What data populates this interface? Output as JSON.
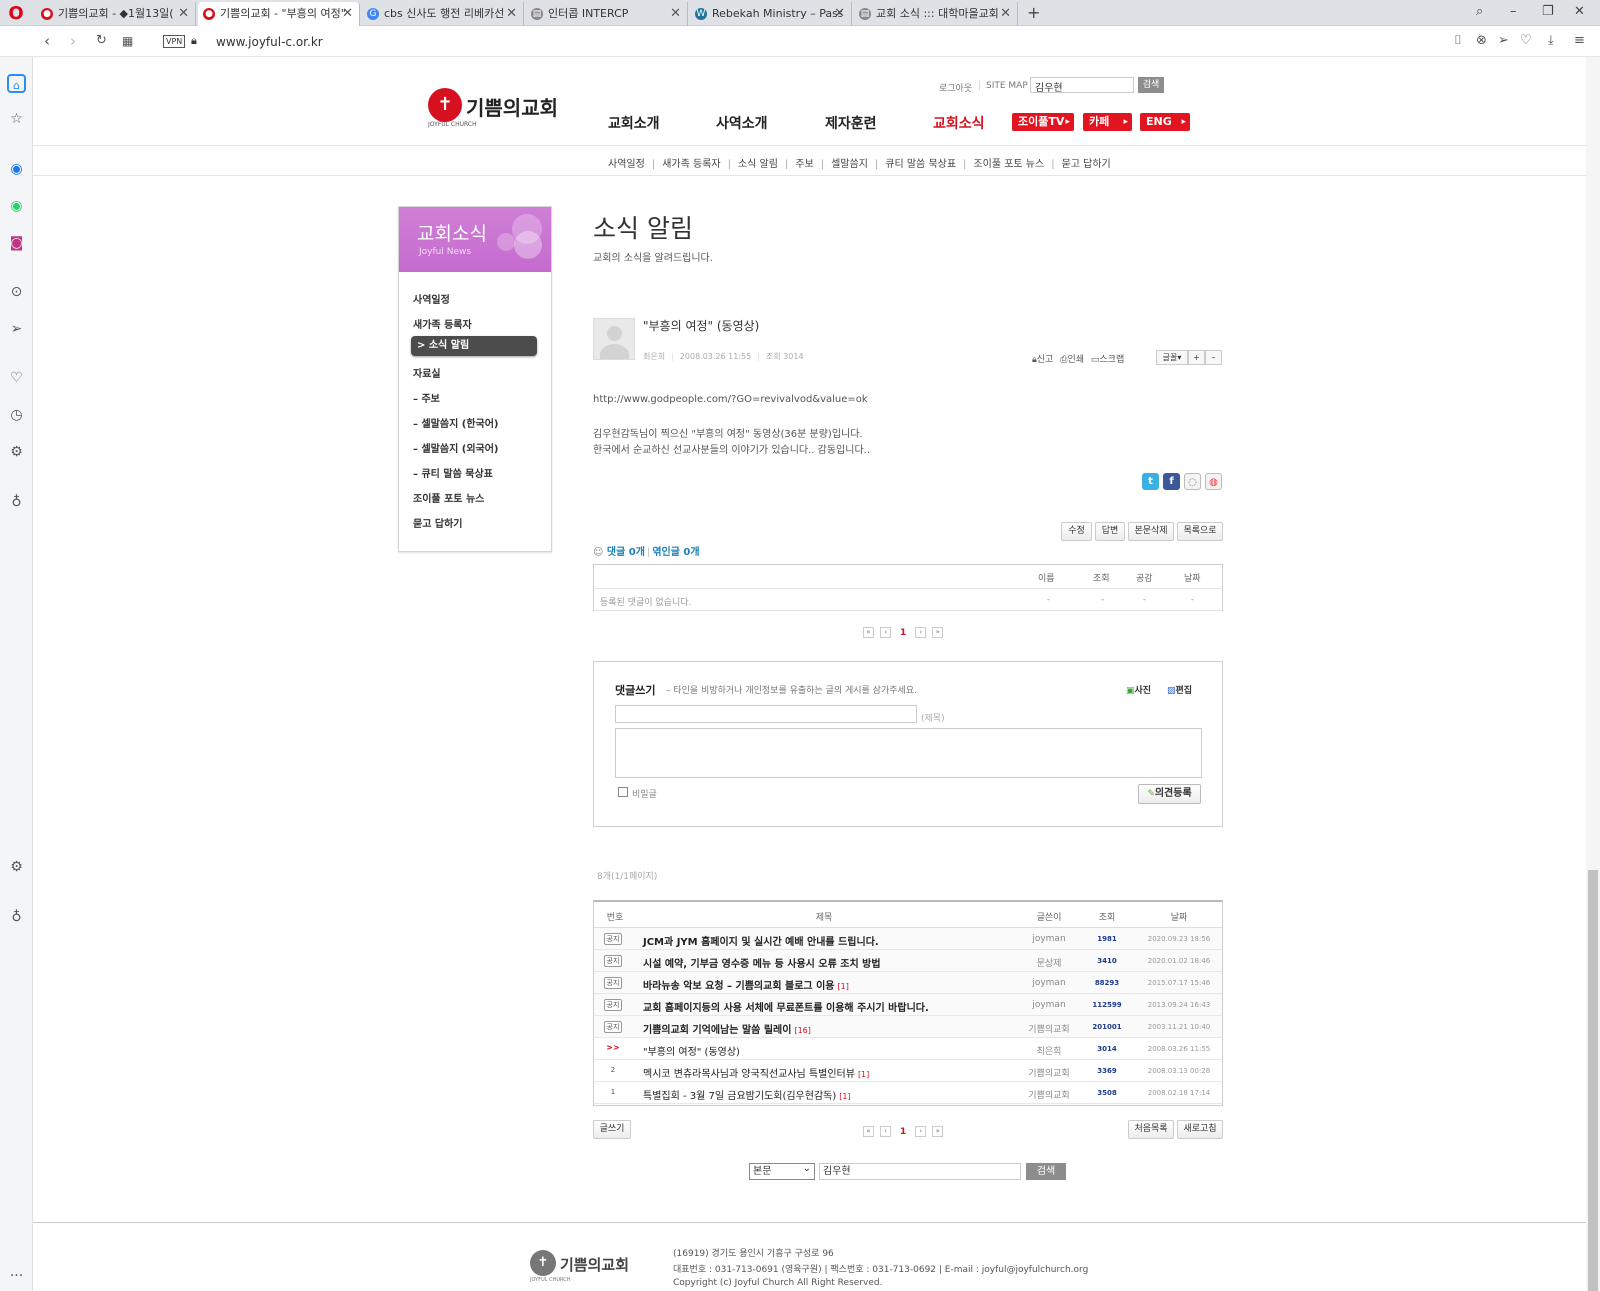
{
  "browser": {
    "tabs": [
      {
        "label": "기쁨의교회 - ◆1월13일(",
        "active": false,
        "icon_color": "#d7101f"
      },
      {
        "label": "기쁨의교회 - \"부흥의 여정\"",
        "active": true,
        "icon_color": "#d7101f"
      },
      {
        "label": "cbs 신사도 행전 리베카선",
        "active": false,
        "icon_color": "#4285f4"
      },
      {
        "label": "인터콥 INTERCP",
        "active": false,
        "icon_color": "#666666"
      },
      {
        "label": "Rebekah Ministry – Passio",
        "active": false,
        "icon_color": "#21759b"
      },
      {
        "label": "교회 소식 ::: 대학마을교회",
        "active": false,
        "icon_color": "#666666"
      }
    ],
    "url": "www.joyful-c.or.kr",
    "vpn_label": "VPN"
  },
  "header": {
    "logo_text": "기쁨의교회",
    "logo_sub": "JOYFUL CHURCH",
    "util": {
      "logout": "로그아웃",
      "sitemap": "SITE MAP",
      "search_value": "김우현",
      "search_btn": "검색"
    },
    "gnb": [
      {
        "label": "교회소개",
        "active": false
      },
      {
        "label": "사역소개",
        "active": false
      },
      {
        "label": "제자훈련",
        "active": false
      },
      {
        "label": "교회소식",
        "active": true
      }
    ],
    "red_buttons": [
      "조이풀TV",
      "카페",
      "ENG"
    ],
    "subnav": [
      "사역일정",
      "새가족 등록자",
      "소식 알림",
      "주보",
      "셀말씀지",
      "큐티 말씀 묵상표",
      "조이풀 포토 뉴스",
      "묻고 답하기"
    ]
  },
  "lnb": {
    "title": "교회소식",
    "subtitle": "Joyful News",
    "items": [
      {
        "label": "사역일정",
        "active": false
      },
      {
        "label": "새가족 등록자",
        "active": false
      },
      {
        "label": "> 소식 알림",
        "active": true
      },
      {
        "label": "자료실",
        "active": false
      },
      {
        "label": "– 주보",
        "active": false
      },
      {
        "label": "– 셀말씀지 (한국어)",
        "active": false
      },
      {
        "label": "– 셀말씀지 (외국어)",
        "active": false
      },
      {
        "label": "– 큐티 말씀 묵상표",
        "active": false
      },
      {
        "label": "조이풀 포토 뉴스",
        "active": false
      },
      {
        "label": "묻고 답하기",
        "active": false
      }
    ]
  },
  "content": {
    "page_title": "소식 알림",
    "page_desc": "교회의 소식을 알려드립니다.",
    "post": {
      "title": "\"부흥의 여정\" (동영상)",
      "author": "최은희",
      "date": "2008.03.26 11:55",
      "views": "조회 3014",
      "tools": [
        "신고",
        "인쇄",
        "스크랩"
      ],
      "font_label": "글꼴",
      "body_link": "http://www.godpeople.com/?GO=revivalvod&value=ok",
      "body_lines": [
        "김우현감독님이 찍으신 \"부흥의 여정\" 동영상(36분 분량)입니다.",
        "한국에서 순교하신 선교사분들의 이야기가 있습니다.. 감동입니다.."
      ],
      "buttons": [
        "수정",
        "답변",
        "본문삭제",
        "목록으로"
      ]
    },
    "comments": {
      "count_label": "댓글 0개",
      "trackback_label": "엮인글 0개",
      "headers": [
        "이름",
        "조회",
        "공감",
        "날짜"
      ],
      "empty": "등록된 댓글이 없습니다.",
      "dash": "-"
    },
    "pager": {
      "current": "1"
    },
    "write": {
      "title": "댓글쓰기",
      "note": "– 타인을 비방하거나 개인정보를 유출하는 글의 게시를 삼가주세요.",
      "photo_label": "사진",
      "edit_label": "편집",
      "subject_label": "(제목)",
      "secret_label": "비밀글",
      "submit_label": "의견등록"
    },
    "list": {
      "count": "8개(1/1페이지)",
      "headers": [
        "번호",
        "제목",
        "글쓴이",
        "조회",
        "날짜"
      ],
      "rows": [
        {
          "no": "공지",
          "title": "JCM과 JYM 홈페이지 및 실시간 예배 안내를 드립니다.",
          "cmt": "",
          "author": "joyman",
          "views": "1981",
          "date": "2020.09.23 18:56",
          "notice": true
        },
        {
          "no": "공지",
          "title": "시설 예약, 기부금 영수증 메뉴 등 사용시 오류 조치 방법",
          "cmt": "",
          "author": "문상제",
          "views": "3410",
          "date": "2020.01.02 18:46",
          "notice": true
        },
        {
          "no": "공지",
          "title": "바라뉴송 악보 요청 – 기쁨의교회 블로그 이용",
          "cmt": "[1]",
          "author": "joyman",
          "views": "88293",
          "date": "2015.07.17 15:46",
          "notice": true
        },
        {
          "no": "공지",
          "title": "교회 홈페이지등의 사용 서체에 무료폰트를 이용해 주시기 바랍니다.",
          "cmt": "",
          "author": "joyman",
          "views": "112599",
          "date": "2013.09.24 16:43",
          "notice": true
        },
        {
          "no": "공지",
          "title": "기쁨의교회 기억에남는 말씀 릴레이",
          "cmt": "[16]",
          "author": "기쁨의교회",
          "views": "201001",
          "date": "2003.11.21 10:40",
          "notice": true
        },
        {
          "no": ">>",
          "title": "\"부흥의 여정\" (동영상)",
          "cmt": "",
          "author": "최은희",
          "views": "3014",
          "date": "2008.03.26 11:55",
          "notice": false,
          "current": true
        },
        {
          "no": "2",
          "title": "멕시코 변츄라목사님과 양국직선교사님 특별인터뷰",
          "cmt": "[1]",
          "author": "기쁨의교회",
          "views": "3369",
          "date": "2008.03.13 00:28",
          "notice": false
        },
        {
          "no": "1",
          "title": "특별집회 - 3월 7일 금요밤기도회(김우현감독)",
          "cmt": "[1]",
          "author": "기쁨의교회",
          "views": "3508",
          "date": "2008.02.18 17:14",
          "notice": false
        }
      ],
      "write_btn": "글쓰기",
      "first_btn": "처음목록",
      "refresh_btn": "새로고침"
    },
    "search": {
      "select": "본문",
      "value": "김우현",
      "btn": "검색"
    }
  },
  "footer": {
    "address": "(16919) 경기도 용인시 기흥구 구성로 96",
    "phone": "대표번호 : 031-713-0691 (영육구원) | 팩스번호 : 031-713-0692 | E-mail : joyful@joyfulchurch.org",
    "copyright": "Copyright (c) Joyful Church All Right Reserved."
  }
}
